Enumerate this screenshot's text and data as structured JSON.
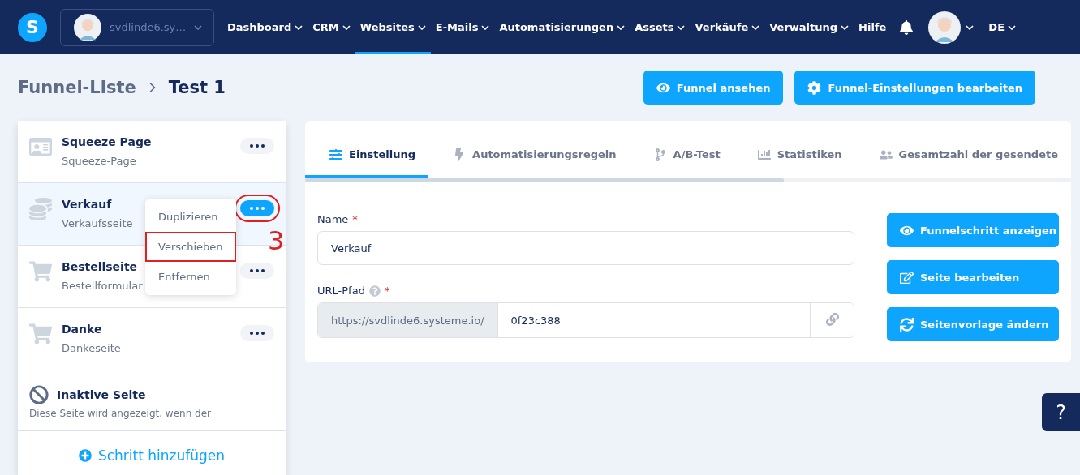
{
  "logo": "S",
  "nav": {
    "account": "svdlinde6.sy…",
    "items": [
      {
        "label": "Dashboard",
        "selected": false,
        "dropdown": true
      },
      {
        "label": "CRM",
        "selected": false,
        "dropdown": true
      },
      {
        "label": "Websites",
        "selected": true,
        "dropdown": true
      },
      {
        "label": "E-Mails",
        "selected": false,
        "dropdown": true
      },
      {
        "label": "Automatisierungen",
        "selected": false,
        "dropdown": true
      },
      {
        "label": "Assets",
        "selected": false,
        "dropdown": true
      },
      {
        "label": "Verkäufe",
        "selected": false,
        "dropdown": true
      },
      {
        "label": "Verwaltung",
        "selected": false,
        "dropdown": true
      },
      {
        "label": "Hilfe",
        "selected": false,
        "dropdown": false
      }
    ],
    "language": "DE"
  },
  "breadcrumb": [
    "Funnel-Liste",
    "Test 1"
  ],
  "header_buttons": [
    {
      "label": "Funnel ansehen"
    },
    {
      "label": "Funnel-Einstellungen bearbeiten"
    }
  ],
  "steps": [
    {
      "title": "Squeeze Page",
      "subtitle": "Squeeze-Page",
      "selected": false,
      "menu_open": false,
      "highlighted": false
    },
    {
      "title": "Verkauf",
      "subtitle": "Verkaufsseite",
      "selected": true,
      "menu_open": true,
      "highlighted": true
    },
    {
      "title": "Bestellseite",
      "subtitle": "Bestellformular",
      "selected": false,
      "menu_open": false,
      "highlighted": false
    },
    {
      "title": "Danke",
      "subtitle": "Dankeseite",
      "selected": false,
      "menu_open": false,
      "highlighted": false
    }
  ],
  "inactive_step": {
    "title": "Inaktive Seite",
    "subtitle": "Diese Seite wird angezeigt, wenn der"
  },
  "step_menu": [
    {
      "label": "Duplizieren",
      "highlighted": false
    },
    {
      "label": "Verschieben",
      "highlighted": true
    },
    {
      "label": "Entfernen",
      "highlighted": false
    }
  ],
  "annotation": {
    "label": "3"
  },
  "add_step": "Schritt hinzufügen",
  "tabs": [
    {
      "label": "Einstellung",
      "selected": true
    },
    {
      "label": "Automatisierungsregeln",
      "selected": false
    },
    {
      "label": "A/B-Test",
      "selected": false
    },
    {
      "label": "Statistiken",
      "selected": false
    },
    {
      "label": "Gesamtzahl der gesendete",
      "selected": false
    }
  ],
  "form": {
    "name_label": "Name",
    "name_required": "*",
    "name_value": "Verkauf",
    "url_label": "URL-Pfad",
    "url_required": "*",
    "url_prefix": "https://svdlinde6.systeme.io/",
    "url_value": "0f23c388"
  },
  "action_buttons": [
    {
      "label": "Funnelschritt anzeigen"
    },
    {
      "label": "Seite bearbeiten"
    },
    {
      "label": "Seitenvorlage ändern"
    }
  ],
  "help_button": "?"
}
